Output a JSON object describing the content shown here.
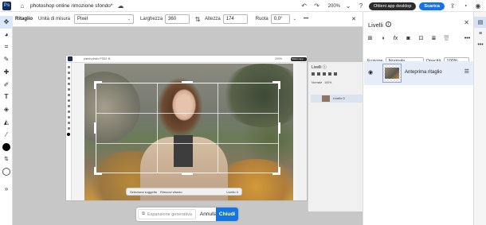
{
  "topbar": {
    "app_logo": "Ps",
    "doc_title": "photoshop online rimozione sfondo*",
    "zoom": "200%",
    "open_desktop": "Ottieni app desktop",
    "download": "Scarica",
    "icons": [
      "home-icon",
      "cloud-sync-icon",
      "undo-icon",
      "redo-icon",
      "chevron-down-icon",
      "help-icon",
      "share-icon",
      "bell-icon",
      "avatar-icon"
    ]
  },
  "options": {
    "tool_name": "Ritaglio",
    "unit_label": "Unità di misura",
    "unit_value": "Pixel",
    "width_label": "Larghezza",
    "width_value": "360",
    "height_label": "Altezza",
    "height_value": "174",
    "rotate_label": "Ruota",
    "rotate_value": "0,0°",
    "more": "•••",
    "close": "✕"
  },
  "tools": [
    "move-tool",
    "lasso-tool",
    "crop-tool",
    "brush-tool",
    "spot-heal-tool",
    "clone-tool",
    "type-tool",
    "eraser-tool",
    "fill-tool",
    "eyedropper-tool"
  ],
  "crop_bar": {
    "generative": "Espansione generativa",
    "cancel": "Annulla",
    "close": "Chiudi"
  },
  "inner_screenshot": {
    "title": "paesh photo PSD2 ⚙",
    "zoom": "200%",
    "desktop": "Ottieni app desktop",
    "download": "Scarica",
    "panel_title": "Livelli ⓘ",
    "blend": "Normale",
    "opacity": "100%",
    "layer": "Livello 0",
    "bottom_toolbar": [
      "Seleziona soggetto",
      "Rimuovi sfondo",
      "Livello 0"
    ]
  },
  "layers_panel": {
    "title": "Livelli",
    "info": "i",
    "blend_label": "Fusione",
    "blend_value": "Normale",
    "opacity_label": "Opacità",
    "opacity_value": "100%",
    "layer_name": "Anteprima ritaglio"
  },
  "colors": {
    "accent": "#1473e6",
    "panel_bg": "#ffffff",
    "canvas_bg": "#c7c7c7",
    "selected_row": "#e5edf8"
  }
}
